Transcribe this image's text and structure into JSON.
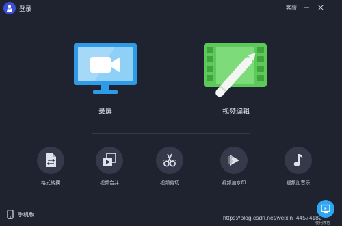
{
  "titlebar": {
    "login_label": "登录",
    "service_label": "客服"
  },
  "main_tools": [
    {
      "label": "录屏",
      "icon": "screen-record-icon",
      "color": "#2f9be8"
    },
    {
      "label": "视频编辑",
      "icon": "video-edit-icon",
      "color": "#5cc95a"
    }
  ],
  "tools": [
    {
      "label": "格式转换",
      "icon": "format-convert-icon"
    },
    {
      "label": "视频合并",
      "icon": "video-merge-icon"
    },
    {
      "label": "视频剪切",
      "icon": "scissors-icon"
    },
    {
      "label": "视频加水印",
      "icon": "watermark-icon"
    },
    {
      "label": "视频加音乐",
      "icon": "music-note-icon"
    }
  ],
  "footer": {
    "mobile_label": "手机版",
    "watermark_text": "https://blog.csdn.net/weixin_44574182",
    "help_label": "使用教程"
  },
  "colors": {
    "background": "#1f2330",
    "circle": "#343a4a",
    "accent_blue": "#2ea7f2",
    "accent_green": "#5cc95a"
  }
}
